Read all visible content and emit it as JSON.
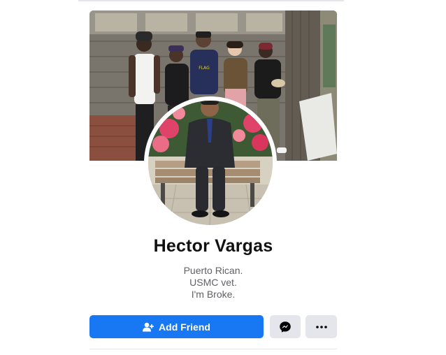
{
  "profile": {
    "name": "Hector Vargas",
    "bio_lines": [
      "Puerto Rican.",
      "USMC vet.",
      "I'm Broke."
    ]
  },
  "actions": {
    "add_friend_label": "Add Friend",
    "add_friend_icon": "add-person-icon",
    "message_icon": "messenger-icon",
    "more_icon": "more-dots-icon"
  },
  "colors": {
    "primary_button": "#1877f2",
    "secondary_button": "#e4e6eb",
    "name_text": "#111111",
    "bio_text": "#5f6166"
  }
}
